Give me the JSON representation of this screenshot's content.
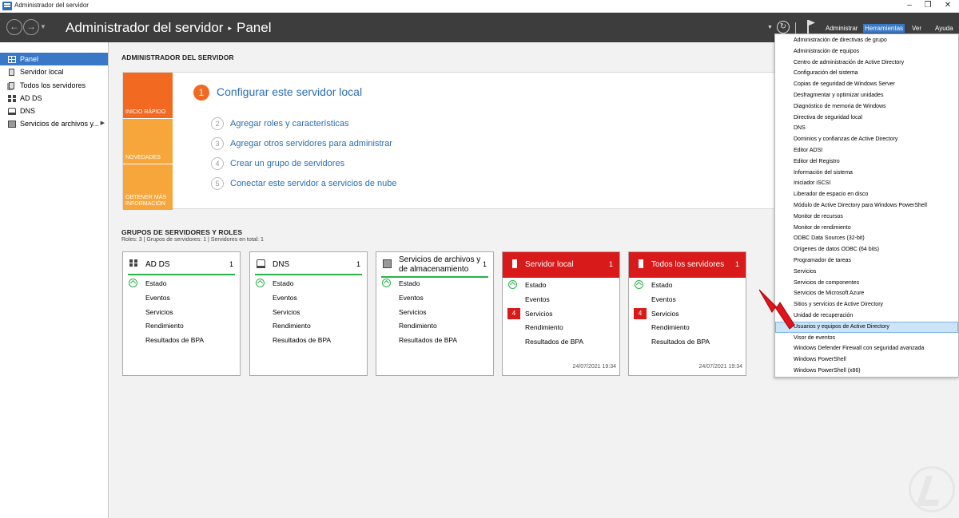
{
  "window": {
    "title": "Administrador del servidor"
  },
  "header": {
    "title": "Administrador del servidor",
    "separator": "▸",
    "page": "Panel",
    "menus": [
      "Administrar",
      "Herramientas",
      "Ver",
      "Ayuda"
    ],
    "active_menu": "Herramientas"
  },
  "sidebar": {
    "items": [
      {
        "label": "Panel",
        "icon": "dashboard-grid-icon",
        "active": true
      },
      {
        "label": "Servidor local",
        "icon": "server-icon"
      },
      {
        "label": "Todos los servidores",
        "icon": "servers-icon"
      },
      {
        "label": "AD DS",
        "icon": "adds-icon"
      },
      {
        "label": "DNS",
        "icon": "dns-icon"
      },
      {
        "label": "Servicios de archivos y...",
        "icon": "file-services-icon",
        "expandable": true
      }
    ]
  },
  "main": {
    "heading": "ADMINISTRADOR DEL SERVIDOR",
    "welcome": {
      "tiles": [
        "INICIO RÁPIDO",
        "NOVEDADES",
        "OBTENER MÁS INFORMACIÓN"
      ],
      "step1": {
        "num": "1",
        "label": "Configurar este servidor local"
      },
      "steps": [
        {
          "num": "2",
          "label": "Agregar roles y características"
        },
        {
          "num": "3",
          "label": "Agregar otros servidores para administrar"
        },
        {
          "num": "4",
          "label": "Crear un grupo de servidores"
        },
        {
          "num": "5",
          "label": "Conectar este servidor a servicios de nube"
        }
      ]
    },
    "roles": {
      "heading": "GRUPOS DE SERVIDORES Y ROLES",
      "summary": "Roles: 3   |   Grupos de servidores: 1   |   Servidores en total: 1",
      "cards": [
        {
          "title": "AD DS",
          "count": "1",
          "red": false,
          "rows": [
            "Estado",
            "Eventos",
            "Servicios",
            "Rendimiento",
            "Resultados de BPA"
          ],
          "date": ""
        },
        {
          "title": "DNS",
          "count": "1",
          "red": false,
          "rows": [
            "Estado",
            "Eventos",
            "Servicios",
            "Rendimiento",
            "Resultados de BPA"
          ],
          "date": ""
        },
        {
          "title": "Servicios de archivos y de almacenamiento",
          "count": "1",
          "red": false,
          "rows": [
            "Estado",
            "Eventos",
            "Servicios",
            "Rendimiento",
            "Resultados de BPA"
          ],
          "date": ""
        },
        {
          "title": "Servidor local",
          "count": "1",
          "red": true,
          "rows": [
            "Estado",
            "Eventos",
            "Servicios",
            "Rendimiento",
            "Resultados de BPA"
          ],
          "badge": "4",
          "date": "24/07/2021 19:34"
        },
        {
          "title": "Todos los servidores",
          "count": "1",
          "red": true,
          "rows": [
            "Estado",
            "Eventos",
            "Servicios",
            "Rendimiento",
            "Resultados de BPA"
          ],
          "badge": "4",
          "date": "24/07/2021 19:34"
        }
      ]
    }
  },
  "tools_menu": {
    "items": [
      "Administración de directivas de grupo",
      "Administración de equipos",
      "Centro de administración de Active Directory",
      "Configuración del sistema",
      "Copias de seguridad de Windows Server",
      "Desfragmentar y optimizar unidades",
      "Diagnóstico de memoria de Windows",
      "Directiva de seguridad local",
      "DNS",
      "Dominios y confianzas de Active Directory",
      "Editor ADSI",
      "Editor del Registro",
      "Información del sistema",
      "Iniciador iSCSI",
      "Liberador de espacio en disco",
      "Módulo de Active Directory para Windows PowerShell",
      "Monitor de recursos",
      "Monitor de rendimiento",
      "ODBC Data Sources (32-bit)",
      "Orígenes de datos ODBC (64 bits)",
      "Programador de tareas",
      "Servicios",
      "Servicios de componentes",
      "Servicios de Microsoft Azure",
      "Sitios y servicios de Active Directory",
      "Unidad de recuperación",
      "Usuarios y equipos de Active Directory",
      "Visor de eventos",
      "Windows Defender Firewall con seguridad avanzada",
      "Windows PowerShell",
      "Windows PowerShell (x86)"
    ],
    "highlighted": "Usuarios y equipos de Active Directory"
  },
  "colors": {
    "accent": "#3878c7",
    "orange": "#f26a22",
    "light_orange": "#f7a63c",
    "alert_red": "#d91a1a",
    "ok_green": "#2bb04a",
    "link_blue": "#2a6db3",
    "menu_highlight": "#cce4f7"
  }
}
